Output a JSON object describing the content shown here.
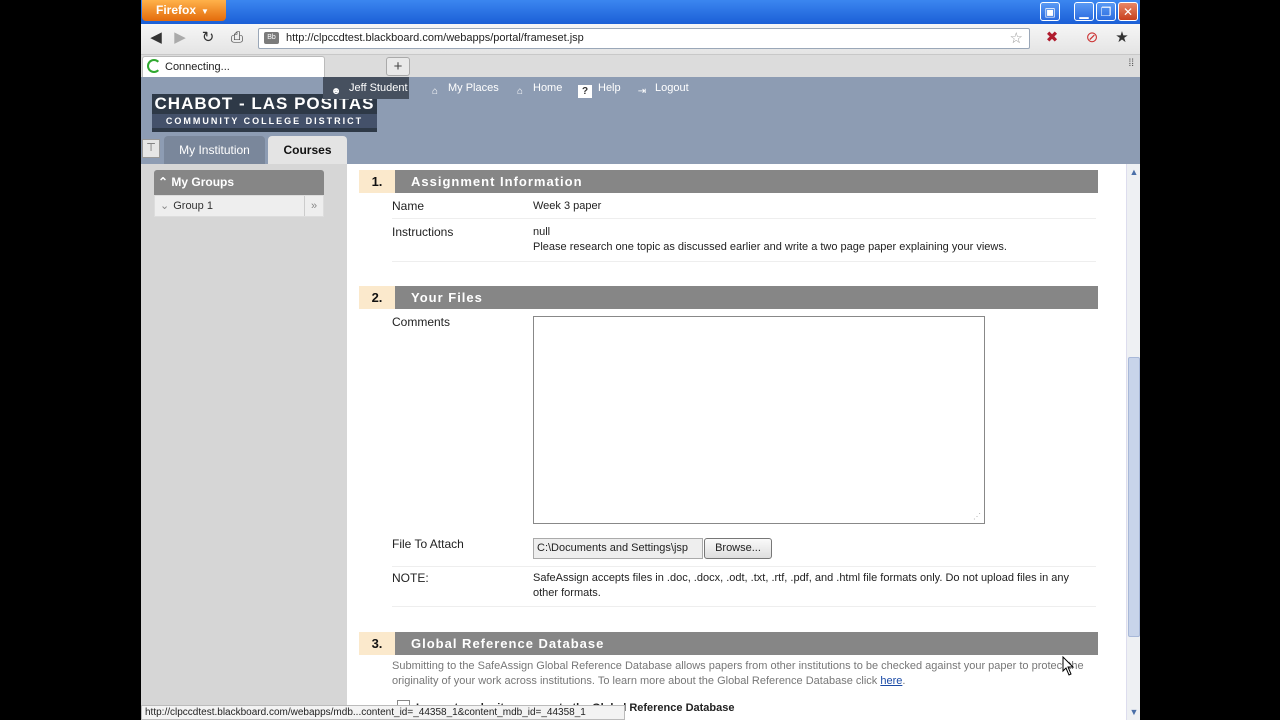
{
  "browser": {
    "menu_button": "Firefox",
    "url": "http://clpccdtest.blackboard.com/webapps/portal/frameset.jsp",
    "favicon_text": "Bb",
    "tab_label": "Connecting...",
    "new_tab": "+",
    "status_text": "http://clpccdtest.blackboard.com/webapps/mdb...content_id=_44358_1&content_mdb_id=_44358_1"
  },
  "header": {
    "logo_line1": "CHABOT - LAS POSITAS",
    "logo_line2": "COMMUNITY COLLEGE DISTRICT",
    "user": "Jeff Student",
    "nav": [
      "My Places",
      "Home",
      "Help",
      "Logout"
    ],
    "tabs": [
      "My Institution",
      "Courses"
    ]
  },
  "sidebar": {
    "heading": "My Groups",
    "items": [
      "Group 1"
    ]
  },
  "sections": [
    {
      "num": "1.",
      "title": "Assignment Information"
    },
    {
      "num": "2.",
      "title": "Your Files"
    },
    {
      "num": "3.",
      "title": "Global Reference Database"
    }
  ],
  "assignment": {
    "name_label": "Name",
    "name_value": "Week 3 paper",
    "instructions_label": "Instructions",
    "instructions_line1": "null",
    "instructions_line2": "Please research one topic as discussed earlier and write a two page paper explaining your views."
  },
  "files": {
    "comments_label": "Comments",
    "comments_value": "",
    "attach_label": "File To Attach",
    "attach_value": "C:\\Documents and Settings\\jsp",
    "browse_label": "Browse...",
    "note_label": "NOTE:",
    "note_text": "SafeAssign accepts files in .doc, .docx, .odt, .txt, .rtf, .pdf, and .html file formats only. Do not upload files in any other formats."
  },
  "grd": {
    "text": "Submitting to the SafeAssign Global Reference Database allows papers from other institutions to be checked against your paper to protect the originality of your work across institutions. To learn more about the Global Reference Database click ",
    "link": "here",
    "after": ".",
    "checkbox_label": "I agree to submit my paper to the Global Reference Database",
    "checkbox_visible": "al Reference Database"
  }
}
